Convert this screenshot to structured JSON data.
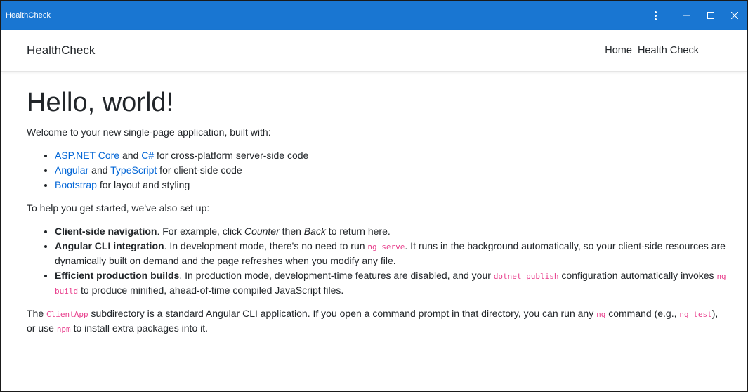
{
  "window": {
    "title": "HealthCheck",
    "controls": {
      "menu": "⋮",
      "minimize": "—",
      "maximize": "☐",
      "close": "✕"
    }
  },
  "navbar": {
    "brand": "HealthCheck",
    "links": [
      "Home",
      "Health Check"
    ]
  },
  "main": {
    "heading": "Hello, world!",
    "intro": "Welcome to your new single-page application, built with:",
    "built_with": [
      {
        "link1": "ASP.NET Core",
        "mid": " and ",
        "link2": "C#",
        "rest": " for cross-platform server-side code"
      },
      {
        "link1": "Angular",
        "mid": " and ",
        "link2": "TypeScript",
        "rest": " for client-side code"
      },
      {
        "link1": "Bootstrap",
        "rest": " for layout and styling"
      }
    ],
    "setup_intro": "To help you get started, we've also set up:",
    "features": [
      {
        "title": "Client-side navigation",
        "t1": ". For example, click ",
        "em1": "Counter",
        "t2": " then ",
        "em2": "Back",
        "t3": " to return here."
      },
      {
        "title": "Angular CLI integration",
        "t1": ". In development mode, there's no need to run ",
        "code1": "ng serve",
        "t2": ". It runs in the background automatically, so your client-side resources are dynamically built on demand and the page refreshes when you modify any file."
      },
      {
        "title": "Efficient production builds",
        "t1": ". In production mode, development-time features are disabled, and your ",
        "code1": "dotnet publish",
        "t2": " configuration automatically invokes ",
        "code2": "ng build",
        "t3": " to produce minified, ahead-of-time compiled JavaScript files."
      }
    ],
    "footer": {
      "t1": "The ",
      "code1": "ClientApp",
      "t2": " subdirectory is a standard Angular CLI application. If you open a command prompt in that directory, you can run any ",
      "code2": "ng",
      "t3": " command (e.g., ",
      "code3": "ng test",
      "t4": "), or use ",
      "code4": "npm",
      "t5": " to install extra packages into it."
    }
  },
  "colors": {
    "titlebar": "#1976d2",
    "link": "#0366d6",
    "code": "#e83e8c",
    "text": "#212529"
  }
}
